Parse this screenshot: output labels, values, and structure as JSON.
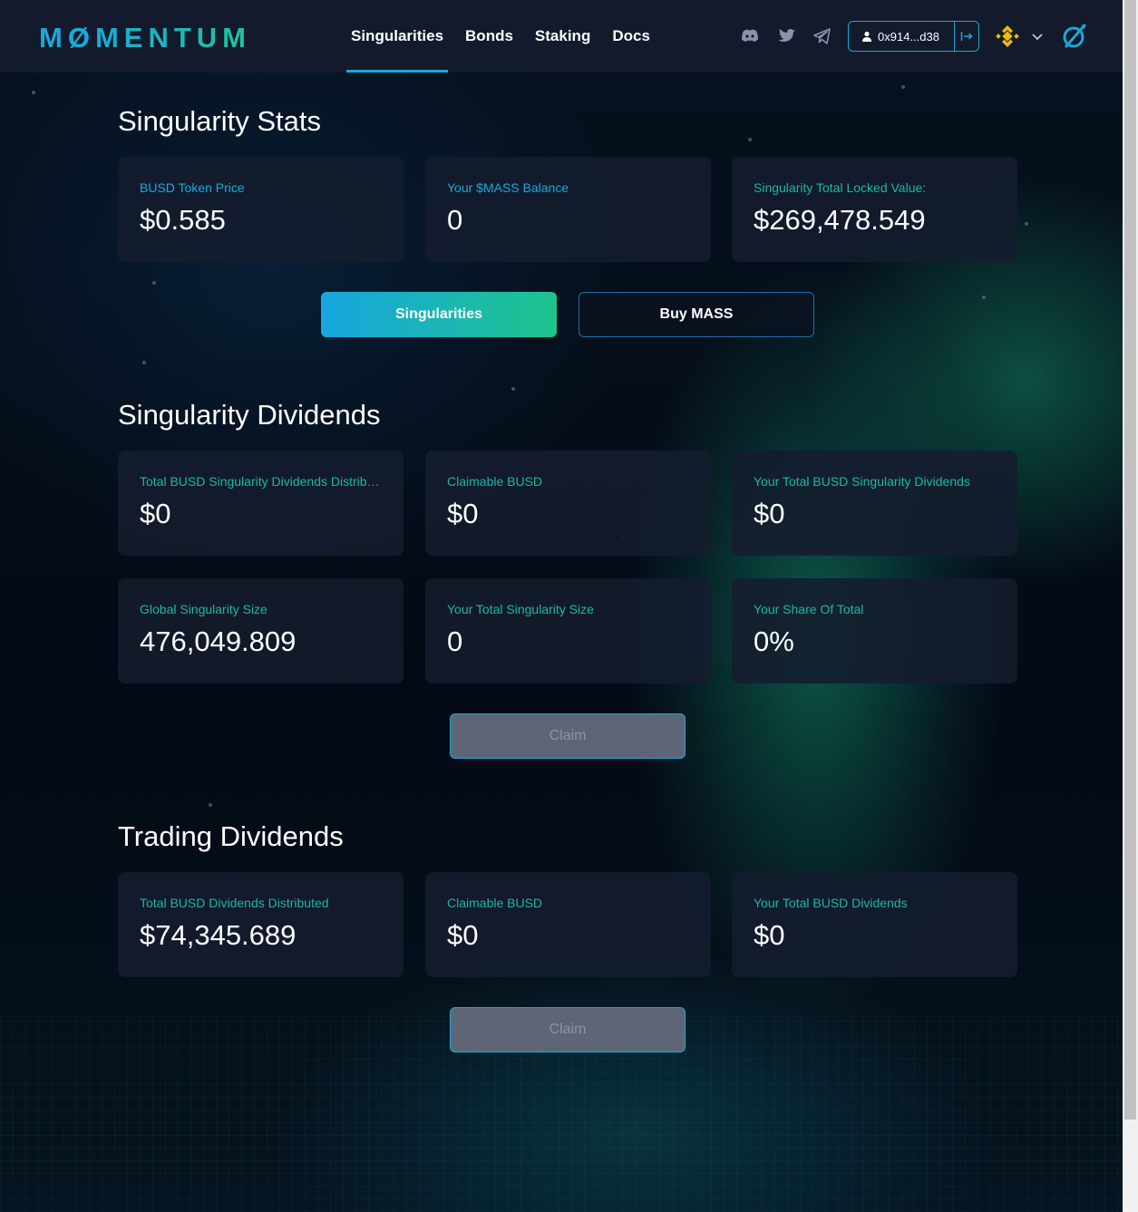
{
  "brand": {
    "logo_m": "M",
    "logo_o": "Ø",
    "logo_rest": "MENTUM"
  },
  "nav": {
    "items": [
      {
        "label": "Singularities",
        "active": true
      },
      {
        "label": "Bonds"
      },
      {
        "label": "Staking"
      },
      {
        "label": "Docs"
      }
    ]
  },
  "header": {
    "icons": [
      "discord-icon",
      "twitter-icon",
      "telegram-icon"
    ],
    "wallet_address": "0x914...d38",
    "network": "binance-icon",
    "accent": "#1aa9d8"
  },
  "singularity_stats": {
    "title": "Singularity Stats",
    "cards": [
      {
        "label": "BUSD Token Price",
        "value": "$0.585"
      },
      {
        "label": "Your $MASS Balance",
        "value": "0"
      },
      {
        "label": "Singularity Total Locked Value:",
        "value": "$269,478.549"
      }
    ],
    "primary_button": "Singularities",
    "secondary_button": "Buy MASS"
  },
  "singularity_dividends": {
    "title": "Singularity Dividends",
    "cards": [
      {
        "label": "Total BUSD Singularity Dividends Distributed",
        "value": "$0"
      },
      {
        "label": "Claimable BUSD",
        "value": "$0"
      },
      {
        "label": "Your Total BUSD Singularity Dividends",
        "value": "$0"
      },
      {
        "label": "Global Singularity Size",
        "value": "476,049.809"
      },
      {
        "label": "Your Total Singularity Size",
        "value": "0"
      },
      {
        "label": "Your Share Of Total",
        "value": "0%"
      }
    ],
    "claim_button": "Claim"
  },
  "trading_dividends": {
    "title": "Trading Dividends",
    "cards": [
      {
        "label": "Total BUSD Dividends Distributed",
        "value": "$74,345.689"
      },
      {
        "label": "Claimable BUSD",
        "value": "$0"
      },
      {
        "label": "Your Total BUSD Dividends",
        "value": "$0"
      }
    ],
    "claim_button": "Claim"
  }
}
